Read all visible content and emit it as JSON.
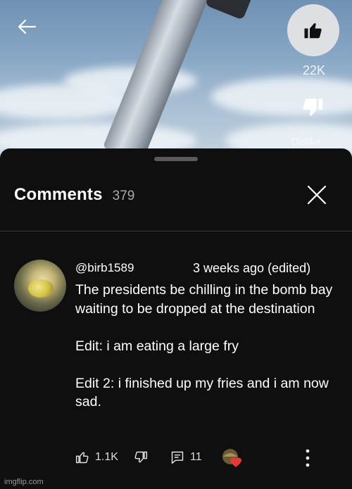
{
  "video": {
    "like_count": "22K",
    "dislike_label": "Dislike",
    "icons": {
      "back": "arrow-left-icon",
      "like": "thumbs-up-filled-icon",
      "dislike": "thumbs-down-filled-icon"
    }
  },
  "comments_sheet": {
    "title": "Comments",
    "count": "379",
    "close_icon": "close-icon"
  },
  "comment": {
    "author": "@birb1589",
    "timestamp": "3 weeks ago (edited)",
    "body": [
      "The presidents be chilling in the bomb bay waiting to be dropped at the destination",
      "",
      "Edit: i am eating a large fry",
      "",
      "Edit 2: i finished up my fries and i am now sad."
    ],
    "like_count": "1.1K",
    "reply_count": "11",
    "icons": {
      "like": "thumbs-up-outline-icon",
      "dislike": "thumbs-down-outline-icon",
      "reply": "reply-icon",
      "creator_heart": "creator-heart-icon",
      "more": "more-vertical-icon"
    },
    "colors": {
      "heart": "#e53935"
    }
  },
  "watermark": "imgflip.com"
}
